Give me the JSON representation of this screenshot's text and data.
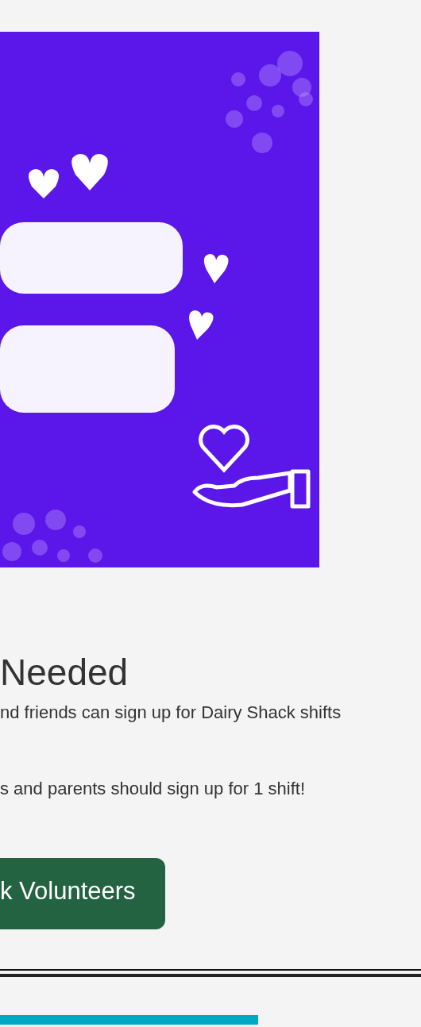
{
  "heading": "Needed",
  "paragraphs": [
    "nd friends can sign up for Dairy Shack shifts",
    "s and parents should sign up for 1 shift!"
  ],
  "button": {
    "label": "k Volunteers"
  },
  "bottom_bar": {
    "kind": "bar"
  }
}
